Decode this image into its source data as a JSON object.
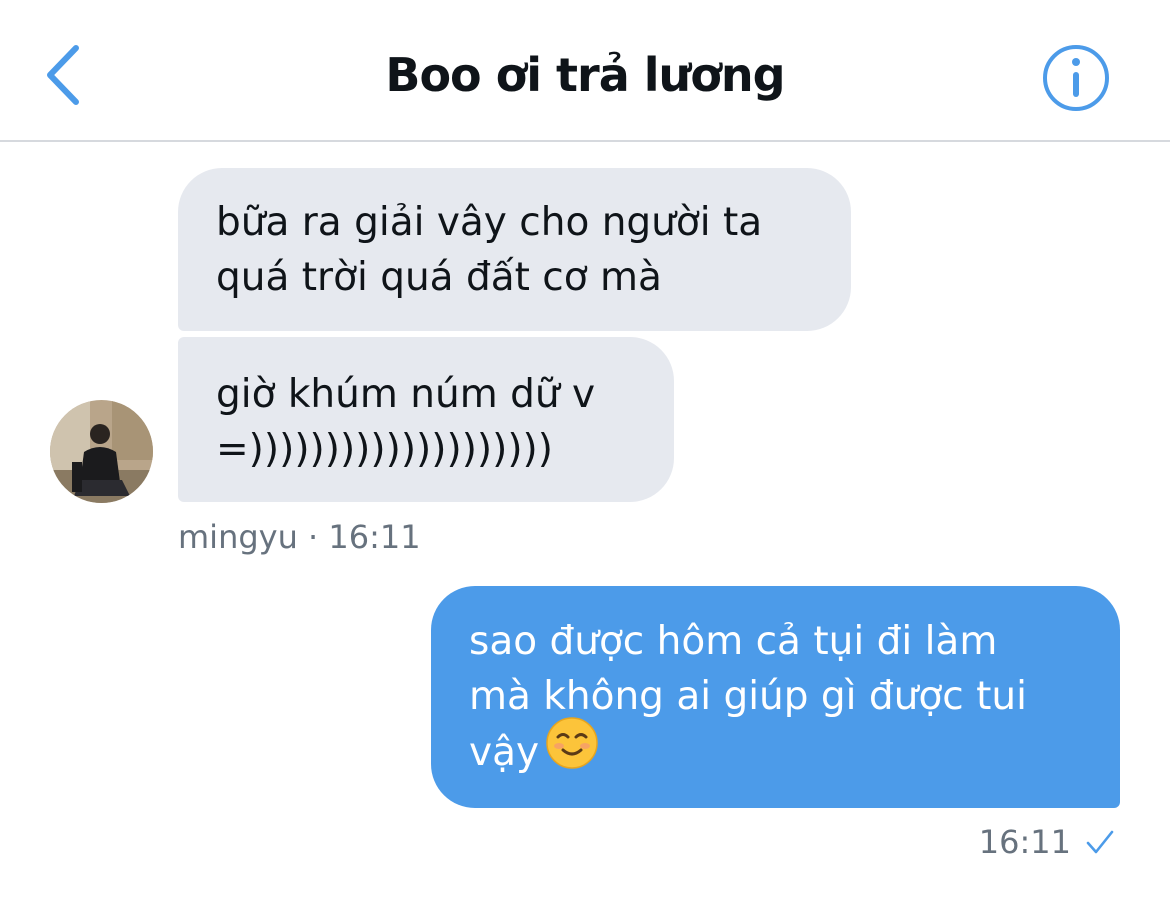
{
  "header": {
    "title": "Boo ơi trả lương"
  },
  "messages": [
    {
      "direction": "in",
      "text": "bữa ra giải vây cho người ta\nquá trời quá đất cơ mà"
    },
    {
      "direction": "in",
      "text": "giờ khúm núm dữ v\n=))))))))))))))))))))"
    },
    {
      "direction": "out",
      "text": "sao được hôm cả tụi đi làm\nmà không ai giúp gì được tui\nvậy",
      "emoji": "smiling-face-emoji"
    }
  ],
  "incoming_meta": {
    "sender": "mingyu",
    "separator": "·",
    "time": "16:11"
  },
  "outgoing_meta": {
    "time": "16:11",
    "status_icon": "checkmark-icon"
  },
  "colors": {
    "accent": "#4c9be9",
    "incoming_bubble": "#e6e9ef",
    "meta_text": "#67727e"
  }
}
